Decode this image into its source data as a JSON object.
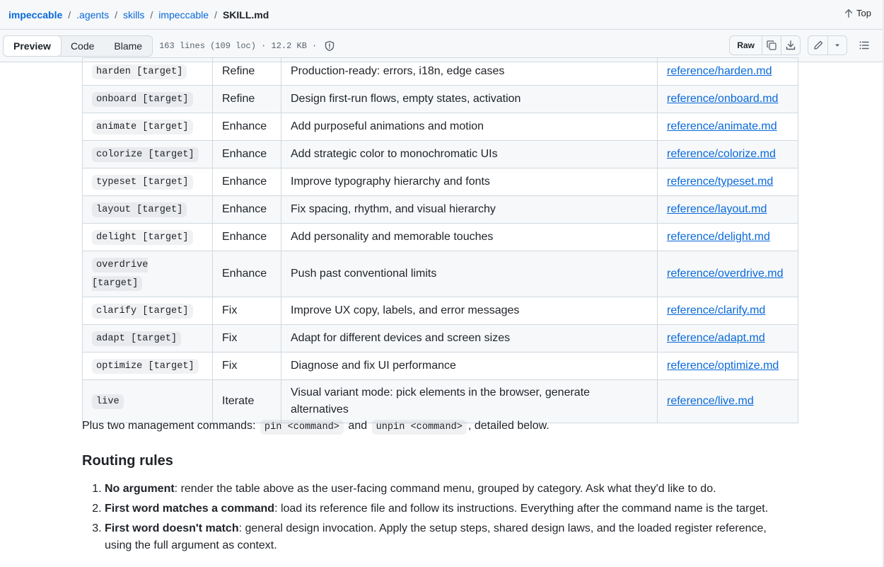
{
  "breadcrumb": {
    "items": [
      "impeccable",
      ".agents",
      "skills",
      "impeccable"
    ],
    "separator": "/",
    "current": "SKILL.md",
    "top_label": "Top"
  },
  "toolbar": {
    "view_tabs": [
      "Preview",
      "Code",
      "Blame"
    ],
    "active_tab": "Preview",
    "file_info": "163 lines (109 loc) · 12.2 KB ·",
    "raw_label": "Raw"
  },
  "commands_table": {
    "rows": [
      {
        "command": "harden [target]",
        "category": "Refine",
        "description": "Production-ready: errors, i18n, edge cases",
        "reference": "reference/harden.md"
      },
      {
        "command": "onboard [target]",
        "category": "Refine",
        "description": "Design first-run flows, empty states, activation",
        "reference": "reference/onboard.md"
      },
      {
        "command": "animate [target]",
        "category": "Enhance",
        "description": "Add purposeful animations and motion",
        "reference": "reference/animate.md"
      },
      {
        "command": "colorize [target]",
        "category": "Enhance",
        "description": "Add strategic color to monochromatic UIs",
        "reference": "reference/colorize.md"
      },
      {
        "command": "typeset [target]",
        "category": "Enhance",
        "description": "Improve typography hierarchy and fonts",
        "reference": "reference/typeset.md"
      },
      {
        "command": "layout [target]",
        "category": "Enhance",
        "description": "Fix spacing, rhythm, and visual hierarchy",
        "reference": "reference/layout.md"
      },
      {
        "command": "delight [target]",
        "category": "Enhance",
        "description": "Add personality and memorable touches",
        "reference": "reference/delight.md"
      },
      {
        "command": "overdrive [target]",
        "category": "Enhance",
        "description": "Push past conventional limits",
        "reference": "reference/overdrive.md"
      },
      {
        "command": "clarify [target]",
        "category": "Fix",
        "description": "Improve UX copy, labels, and error messages",
        "reference": "reference/clarify.md"
      },
      {
        "command": "adapt [target]",
        "category": "Fix",
        "description": "Adapt for different devices and screen sizes",
        "reference": "reference/adapt.md"
      },
      {
        "command": "optimize [target]",
        "category": "Fix",
        "description": "Diagnose and fix UI performance",
        "reference": "reference/optimize.md"
      },
      {
        "command": "live",
        "category": "Iterate",
        "description": "Visual variant mode: pick elements in the browser, generate alternatives",
        "reference": "reference/live.md"
      }
    ]
  },
  "management": {
    "prefix": "Plus two management commands:",
    "pin": "pin <command>",
    "and": "and",
    "unpin": "unpin <command>",
    "suffix": ", detailed below."
  },
  "routing": {
    "title": "Routing rules",
    "rules": [
      {
        "bold": "No argument",
        "text": ": render the table above as the user-facing command menu, grouped by category. Ask what they'd like to do."
      },
      {
        "bold": "First word matches a command",
        "text": ": load its reference file and follow its instructions. Everything after the command name is the target."
      },
      {
        "bold": "First word doesn't match",
        "text": ": general design invocation. Apply the setup steps, shared design laws, and the loaded register reference, using the full argument as context."
      }
    ]
  },
  "colors": {
    "link": "#0969da",
    "border": "#d1d9e0",
    "header_bg": "#f6f8fa",
    "text": "#1f2328",
    "muted": "#59636e"
  },
  "icons": [
    "arrow-up-icon",
    "shield-icon",
    "copy-icon",
    "download-icon",
    "pencil-icon",
    "triangle-down-icon",
    "list-icon"
  ]
}
